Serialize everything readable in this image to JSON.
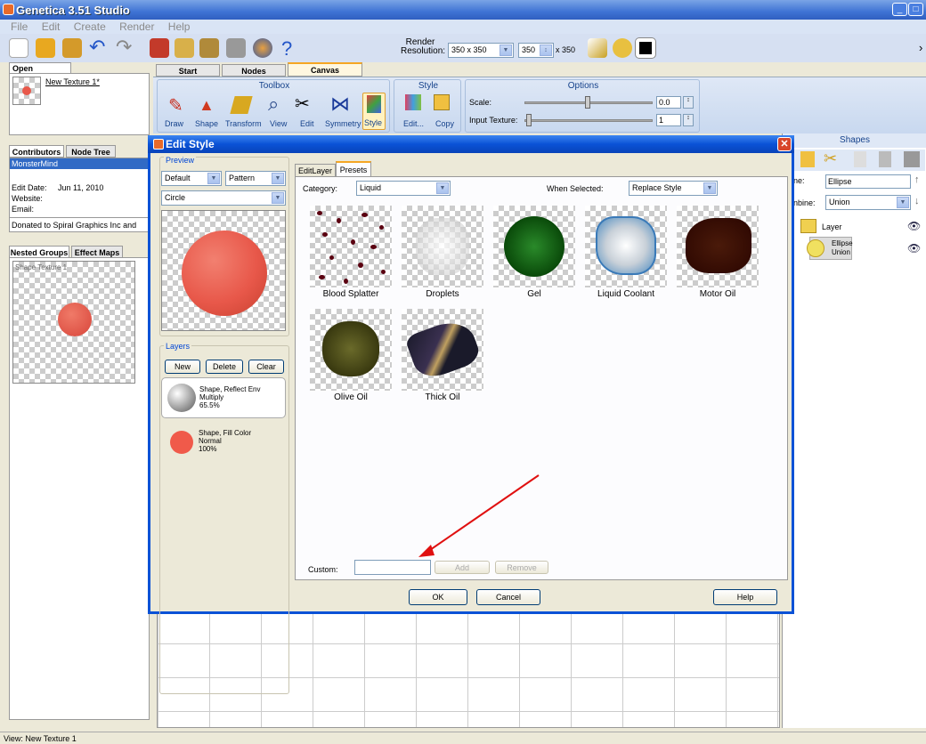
{
  "app": {
    "title": "Genetica 3.51 Studio",
    "minimize": "_",
    "maximize": "□"
  },
  "menu": [
    "File",
    "Edit",
    "Create",
    "Render",
    "Help"
  ],
  "toolbar": {
    "render_label": "Render Resolution:",
    "resolution": "350 x 350",
    "width": "350",
    "x_label": "x 350"
  },
  "open_textures": {
    "tab": "Open Textures",
    "item": "New Texture 1*"
  },
  "main_tabs": [
    "Start",
    "Nodes",
    "Canvas"
  ],
  "toolbox": {
    "title": "Toolbox",
    "tools": [
      "Draw",
      "Shape",
      "Transform",
      "View",
      "Edit",
      "Symmetry",
      "Style"
    ]
  },
  "style_group": {
    "title": "Style",
    "buttons": [
      "Edit...",
      "Copy"
    ]
  },
  "options": {
    "title": "Options",
    "scale_label": "Scale:",
    "scale_value": "0.0",
    "input_label": "Input Texture:",
    "input_value": "1"
  },
  "contributors": {
    "tabs": [
      "Contributors",
      "Node Tree"
    ],
    "name": "MonsterMind",
    "edit_date_label": "Edit Date:",
    "edit_date": "Jun 11, 2010",
    "website_label": "Website:",
    "email_label": "Email:",
    "donated": "Donated to Spiral Graphics Inc and"
  },
  "nested": {
    "tabs": [
      "Nested Groups",
      "Effect Maps"
    ],
    "item": "Shape Texture 1"
  },
  "shapes_panel": {
    "title": "Shapes",
    "name_label": "ne:",
    "name_value": "Ellipse",
    "combine_label": "nbine:",
    "combine_value": "Union",
    "layer": "Layer",
    "shape_name": "Ellipse",
    "shape_mode": "Union"
  },
  "dialog": {
    "title": "Edit Style",
    "preview_label": "Preview",
    "preview_select1": "Default",
    "preview_select2": "Pattern",
    "preview_select3": "Circle",
    "layers_label": "Layers",
    "layer_buttons": [
      "New",
      "Delete",
      "Clear"
    ],
    "layers": [
      {
        "name": "Shape, Reflect Env",
        "mode": "Multiply",
        "opacity": "65.5%"
      },
      {
        "name": "Shape, Fill Color",
        "mode": "Normal",
        "opacity": "100%"
      }
    ],
    "tabs": [
      "EditLayer",
      "Presets"
    ],
    "category_label": "Category:",
    "category": "Liquid",
    "when_label": "When Selected:",
    "when_value": "Replace Style",
    "presets": [
      "Blood Splatter",
      "Droplets",
      "Gel",
      "Liquid Coolant",
      "Motor Oil",
      "Olive Oil",
      "Thick Oil"
    ],
    "custom_label": "Custom:",
    "custom_value": "",
    "add": "Add",
    "remove": "Remove",
    "ok": "OK",
    "cancel": "Cancel",
    "help": "Help"
  },
  "status": "View: New Texture 1",
  "colors": {
    "accent": "#0a52d6",
    "arrow": "#e01010",
    "ball": "#e8584a"
  }
}
